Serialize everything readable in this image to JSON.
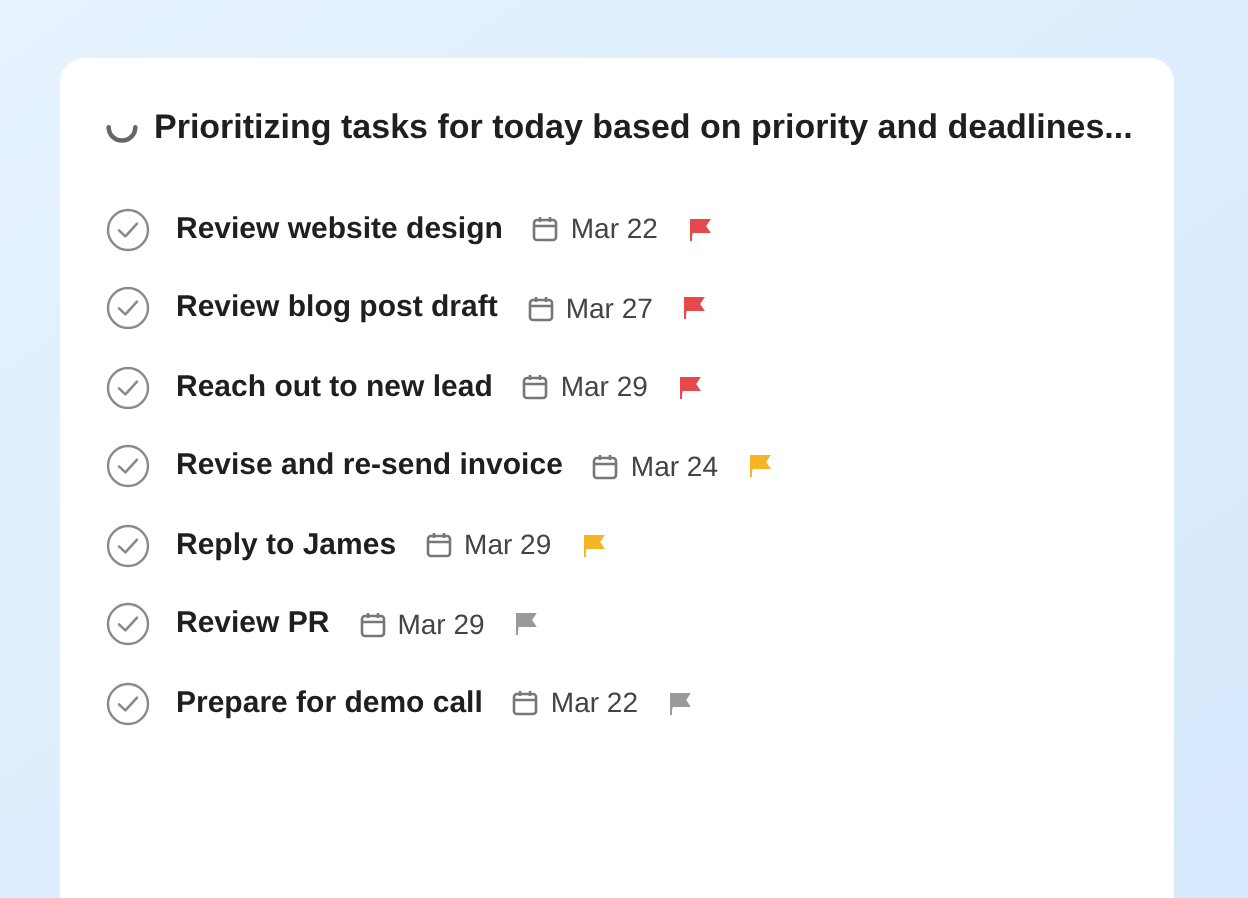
{
  "status": {
    "text": "Prioritizing tasks for today based on priority and deadlines..."
  },
  "tasks": [
    {
      "title": "Review website design",
      "date": "Mar 22",
      "color": "#e5484d"
    },
    {
      "title": "Review blog post draft",
      "date": "Mar 27",
      "color": "#e5484d"
    },
    {
      "title": "Reach out to new lead",
      "date": "Mar 29",
      "color": "#e5484d"
    },
    {
      "title": "Revise and re-send invoice",
      "date": "Mar 24",
      "color": "#f5b524"
    },
    {
      "title": "Reply to James",
      "date": "Mar 29",
      "color": "#f5b524"
    },
    {
      "title": "Review PR",
      "date": "Mar 29",
      "color": "#9a9a9a"
    },
    {
      "title": "Prepare for demo call",
      "date": "Mar 22",
      "color": "#9a9a9a"
    }
  ]
}
